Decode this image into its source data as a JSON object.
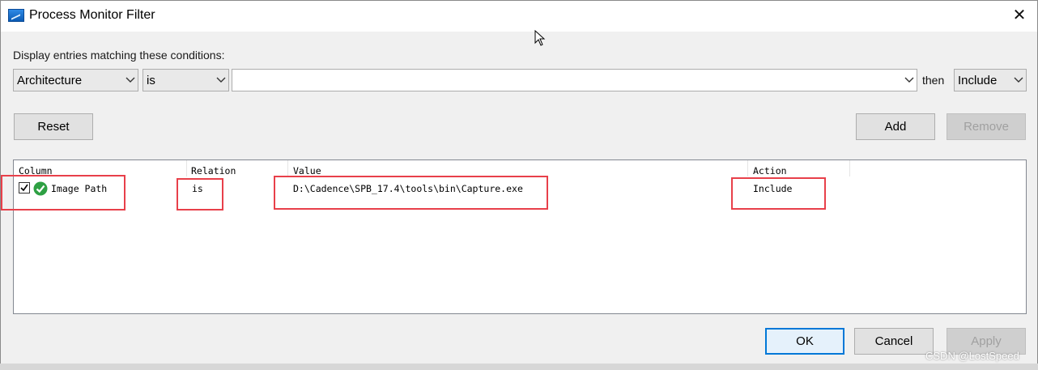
{
  "window": {
    "title": "Process Monitor Filter"
  },
  "prompt": "Display entries matching these conditions:",
  "filter_row": {
    "column": "Architecture",
    "relation": "is",
    "value": "",
    "then_label": "then",
    "action": "Include"
  },
  "buttons": {
    "reset": "Reset",
    "add": "Add",
    "remove": "Remove",
    "ok": "OK",
    "cancel": "Cancel",
    "apply": "Apply"
  },
  "list": {
    "headers": [
      "Column",
      "Relation",
      "Value",
      "Action"
    ],
    "rows": [
      {
        "column": "Image Path",
        "relation": "is",
        "value": "D:\\Cadence\\SPB_17.4\\tools\\bin\\Capture.exe",
        "action": "Include",
        "checked": true
      }
    ]
  },
  "watermark": "CSDN @LostSpeed",
  "colors": {
    "highlight": "#e8404a",
    "default_button_border": "#0078d7"
  },
  "icons": {
    "app": "process-monitor-icon",
    "close": "close-icon",
    "row_status": "checkmark-green-icon"
  }
}
